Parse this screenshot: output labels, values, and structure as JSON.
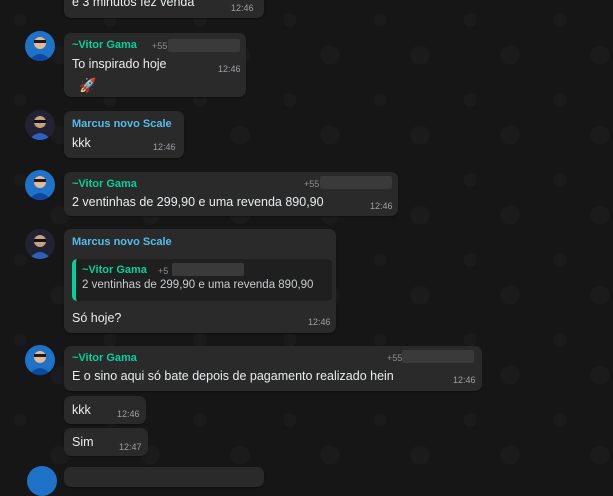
{
  "colors": {
    "vitor": "#06cf9c",
    "marcus": "#53bdeb",
    "bubble": "#2a2a2a",
    "background": "#161616"
  },
  "messages": {
    "m0": {
      "text": "e 3 minutos fez venda",
      "time": "12:46"
    },
    "m1": {
      "sender": "~Vitor Gama",
      "phone": "+55",
      "text": "To inspirado hoje",
      "time": "12:46",
      "emoji": "🚀"
    },
    "m2": {
      "sender": "Marcus novo Scale",
      "text": "kkk",
      "time": "12:46"
    },
    "m3": {
      "sender": "~Vitor Gama",
      "phone": "+55",
      "text": "2 ventinhas de 299,90 e uma revenda 890,90",
      "time": "12:46"
    },
    "m4": {
      "sender": "Marcus novo Scale",
      "quote": {
        "sender": "~Vitor Gama",
        "phone": "+5",
        "text": "2 ventinhas de 299,90 e uma revenda 890,90"
      },
      "text": "Só hoje?",
      "time": "12:46"
    },
    "m5": {
      "sender": "~Vitor Gama",
      "phone": "+55",
      "text": "E o sino aqui só bate depois de pagamento realizado hein",
      "time": "12:46"
    },
    "m6": {
      "text": "kkk",
      "time": "12:46"
    },
    "m7": {
      "text": "Sim",
      "time": "12:47"
    }
  }
}
